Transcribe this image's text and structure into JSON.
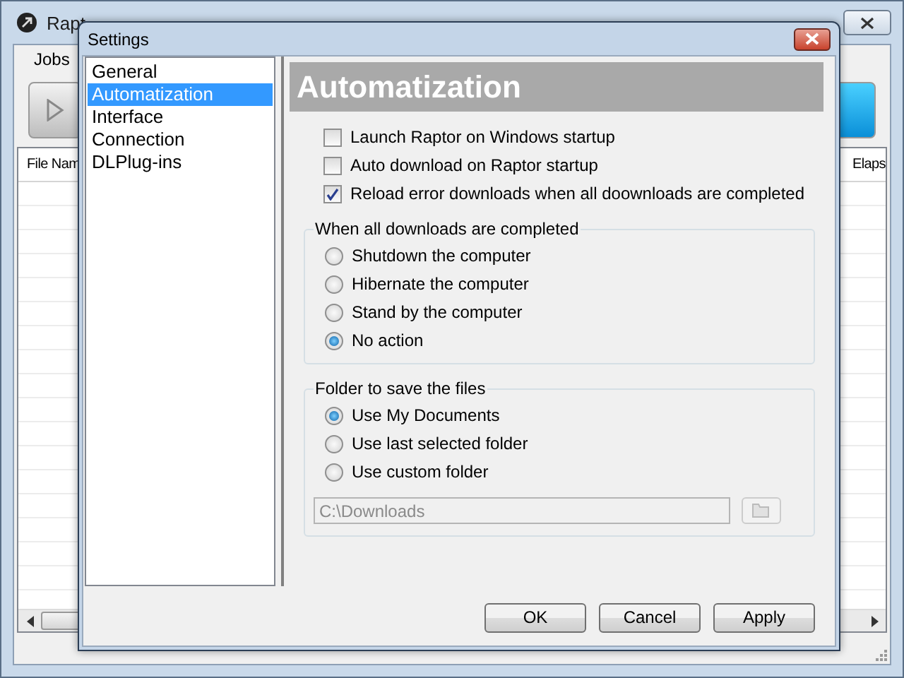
{
  "app": {
    "title": "Rapt",
    "menu": [
      "Jobs"
    ],
    "columns": [
      {
        "label": "File Nam"
      },
      {
        "label": "Elaps"
      }
    ]
  },
  "dialog": {
    "title": "Settings",
    "nav": [
      {
        "label": "General",
        "selected": false
      },
      {
        "label": "Automatization",
        "selected": true
      },
      {
        "label": "Interface",
        "selected": false
      },
      {
        "label": "Connection",
        "selected": false
      },
      {
        "label": "DLPlug-ins",
        "selected": false
      }
    ],
    "heading": "Automatization",
    "options": [
      {
        "label": "Launch Raptor on Windows startup",
        "checked": false
      },
      {
        "label": "Auto download on Raptor startup",
        "checked": false
      },
      {
        "label": "Reload error downloads when all doownloads are completed",
        "checked": true
      }
    ],
    "groups": [
      {
        "title": "When all downloads are completed",
        "choices": [
          {
            "label": "Shutdown the computer",
            "selected": false
          },
          {
            "label": "Hibernate the computer",
            "selected": false
          },
          {
            "label": "Stand by the computer",
            "selected": false
          },
          {
            "label": "No action",
            "selected": true
          }
        ]
      },
      {
        "title": "Folder to save the files",
        "choices": [
          {
            "label": "Use My Documents",
            "selected": true
          },
          {
            "label": "Use last selected folder",
            "selected": false
          },
          {
            "label": "Use custom folder",
            "selected": false
          }
        ],
        "folder": {
          "value": "C:\\Downloads",
          "disabled": true
        }
      }
    ],
    "buttons": [
      "OK",
      "Cancel",
      "Apply"
    ]
  }
}
